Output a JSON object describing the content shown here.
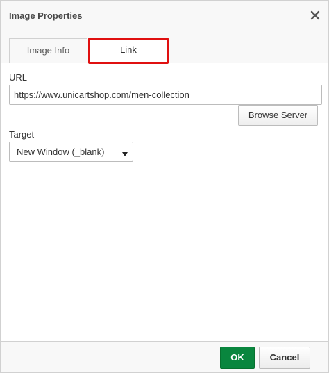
{
  "dialog": {
    "title": "Image Properties",
    "close_icon": "close-icon"
  },
  "tabs": [
    {
      "label": "Image Info",
      "selected": false
    },
    {
      "label": "Link",
      "selected": true,
      "highlight_color": "#e01010"
    }
  ],
  "link": {
    "url_label": "URL",
    "url_value": "https://www.unicartshop.com/men-collection",
    "browse_label": "Browse Server",
    "target_label": "Target",
    "target_value": "New Window (_blank)",
    "target_arrow_icon": "dropdown-arrow-icon"
  },
  "footer": {
    "ok_label": "OK",
    "cancel_label": "Cancel",
    "ok_color": "#09863e"
  }
}
